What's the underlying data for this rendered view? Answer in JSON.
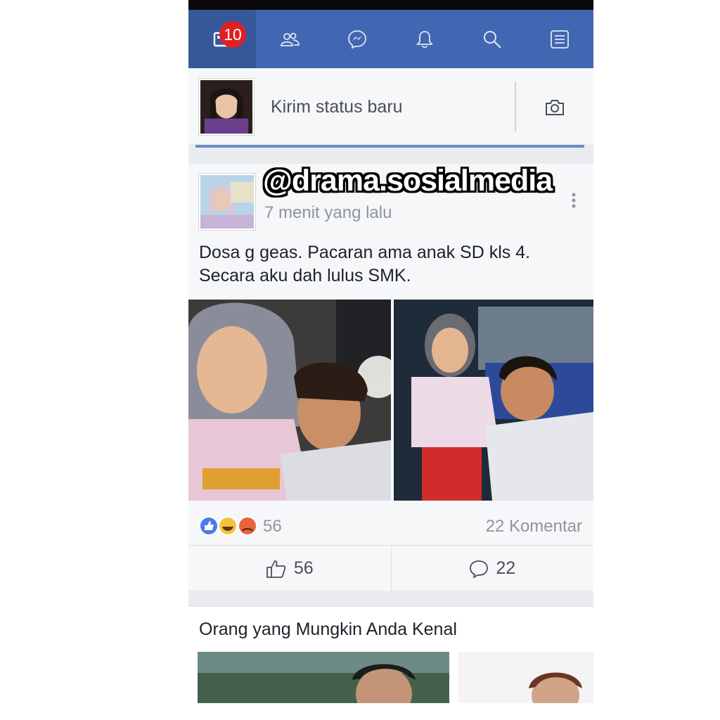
{
  "nav": {
    "items": [
      {
        "icon": "news-feed-icon",
        "badge": "10"
      },
      {
        "icon": "friends-icon"
      },
      {
        "icon": "messenger-icon"
      },
      {
        "icon": "notifications-bell-icon"
      },
      {
        "icon": "search-icon"
      },
      {
        "icon": "menu-list-icon"
      }
    ],
    "color": "#4267b2"
  },
  "composer": {
    "placeholder": "Kirim status baru"
  },
  "post": {
    "watermark": "@drama.sosialmedia",
    "timestamp": "7 menit yang lalu",
    "text_line1": "Dosa g geas. Pacaran ama anak SD kls 4.",
    "text_line2": "Secara aku dah lulus SMK.",
    "reaction_count": "56",
    "comment_count": "22 Komentar",
    "like_count": "56",
    "comments": "22"
  },
  "pymk": {
    "title": "Orang yang Mungkin Anda Kenal"
  }
}
